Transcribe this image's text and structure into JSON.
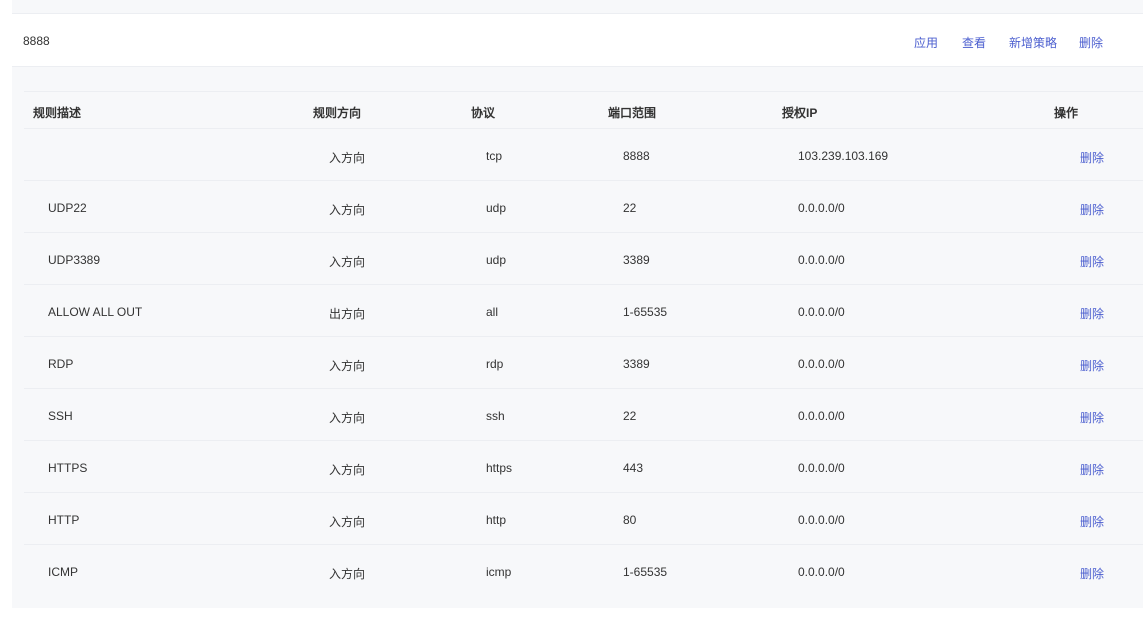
{
  "group": {
    "name": "8888",
    "actions": {
      "apply": "应用",
      "view": "查看",
      "add_policy": "新增策略",
      "delete": "删除"
    }
  },
  "table": {
    "headers": {
      "description": "规则描述",
      "direction": "规则方向",
      "protocol": "协议",
      "port_range": "端口范围",
      "authorized_ip": "授权IP",
      "operation": "操作"
    },
    "rows": [
      {
        "description": "",
        "direction": "入方向",
        "protocol": "tcp",
        "port": "8888",
        "ip": "103.239.103.169",
        "op": "删除"
      },
      {
        "description": "UDP22",
        "direction": "入方向",
        "protocol": "udp",
        "port": "22",
        "ip": "0.0.0.0/0",
        "op": "删除"
      },
      {
        "description": "UDP3389",
        "direction": "入方向",
        "protocol": "udp",
        "port": "3389",
        "ip": "0.0.0.0/0",
        "op": "删除"
      },
      {
        "description": "ALLOW ALL OUT",
        "direction": "出方向",
        "protocol": "all",
        "port": "1-65535",
        "ip": "0.0.0.0/0",
        "op": "删除"
      },
      {
        "description": "RDP",
        "direction": "入方向",
        "protocol": "rdp",
        "port": "3389",
        "ip": "0.0.0.0/0",
        "op": "删除"
      },
      {
        "description": "SSH",
        "direction": "入方向",
        "protocol": "ssh",
        "port": "22",
        "ip": "0.0.0.0/0",
        "op": "删除"
      },
      {
        "description": "HTTPS",
        "direction": "入方向",
        "protocol": "https",
        "port": "443",
        "ip": "0.0.0.0/0",
        "op": "删除"
      },
      {
        "description": "HTTP",
        "direction": "入方向",
        "protocol": "http",
        "port": "80",
        "ip": "0.0.0.0/0",
        "op": "删除"
      },
      {
        "description": "ICMP",
        "direction": "入方向",
        "protocol": "icmp",
        "port": "1-65535",
        "ip": "0.0.0.0/0",
        "op": "删除"
      }
    ]
  }
}
